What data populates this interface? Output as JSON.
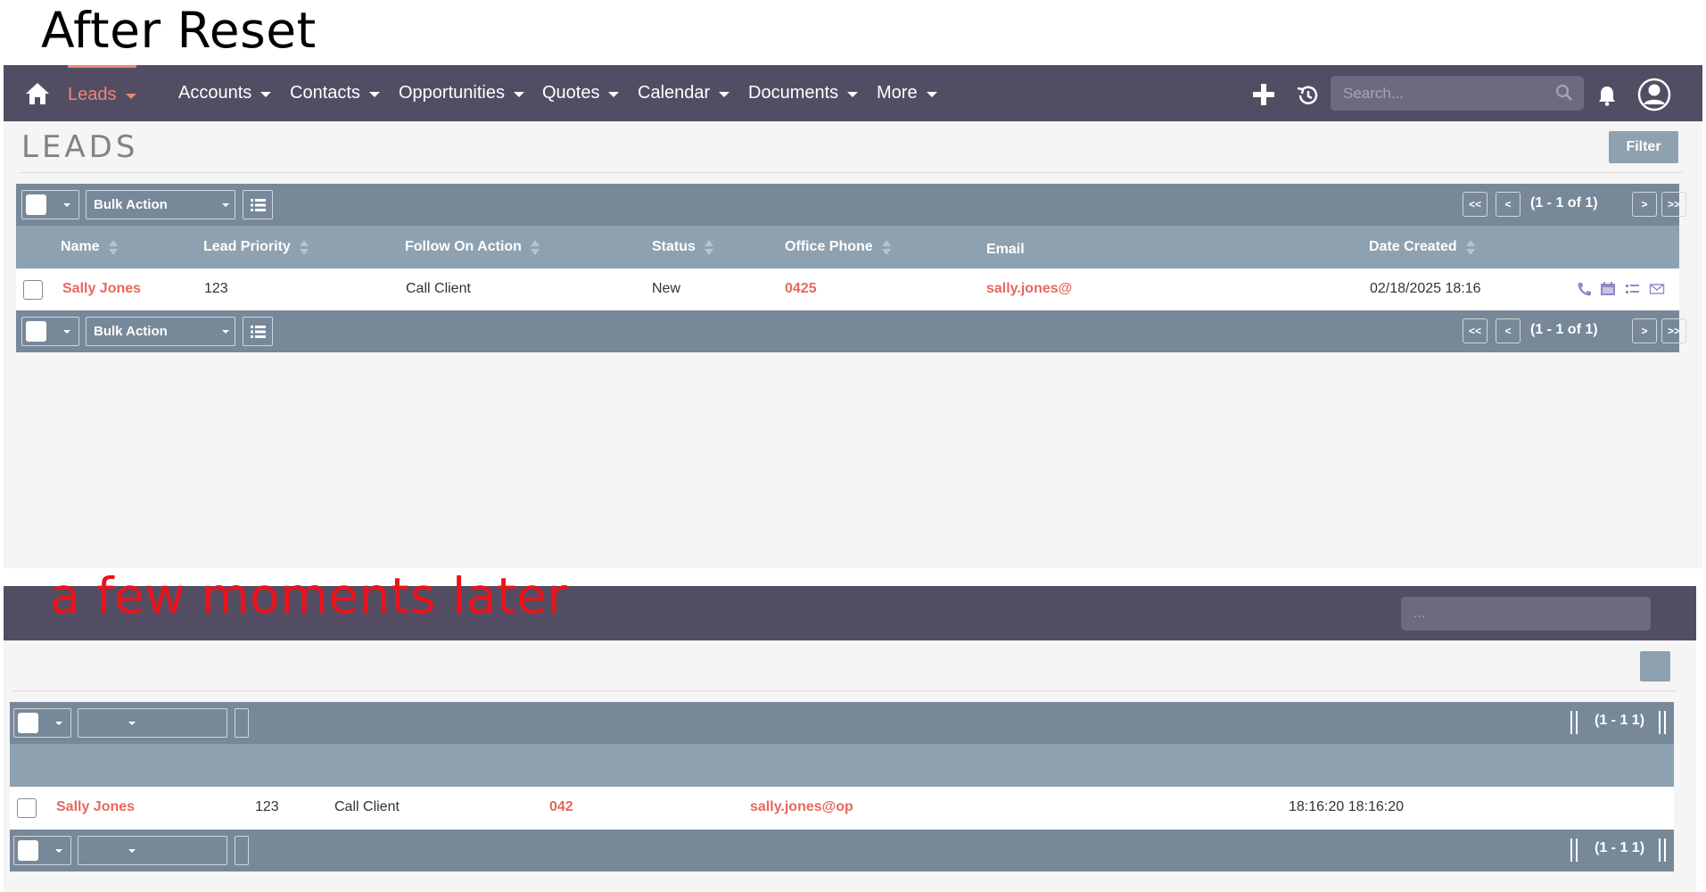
{
  "captions": {
    "top": "After Reset",
    "bottom": "a few moments later"
  },
  "nav": {
    "items": [
      "Leads",
      "Accounts",
      "Contacts",
      "Opportunities",
      "Quotes",
      "Calendar",
      "Documents",
      "More"
    ],
    "active": "Leads",
    "search_placeholder": "Search...",
    "accent_color": "#f08377",
    "bar_color": "#534d64"
  },
  "page": {
    "title": "LEADS",
    "filter_label": "Filter"
  },
  "toolbar": {
    "bulk_label": "Bulk Action",
    "first": "<<",
    "prev": "<",
    "next": ">",
    "last": ">>",
    "pagination": "(1 - 1 of 1)"
  },
  "table": {
    "columns": [
      "Name",
      "Lead Priority",
      "Follow On Action",
      "Status",
      "Office Phone",
      "Email",
      "Date Created"
    ],
    "rows": [
      {
        "name": "Sally Jones",
        "priority": "123",
        "follow_on": "Call Client",
        "status": "New",
        "phone": "0425",
        "email": "sally.jones@",
        "date_created": "02/18/2025 18:16"
      }
    ],
    "row_icons": [
      "phone-icon",
      "calendar-icon",
      "list-icon",
      "envelope-icon"
    ]
  },
  "later": {
    "search_placeholder": "...",
    "pagination": "(1 - 1 1)",
    "row": {
      "name": "Sally Jones",
      "priority": "123",
      "follow_on": "Call Client",
      "phone": "042",
      "email": "sally.jones@op",
      "date_created": "18:16:20 18:16:20"
    }
  }
}
